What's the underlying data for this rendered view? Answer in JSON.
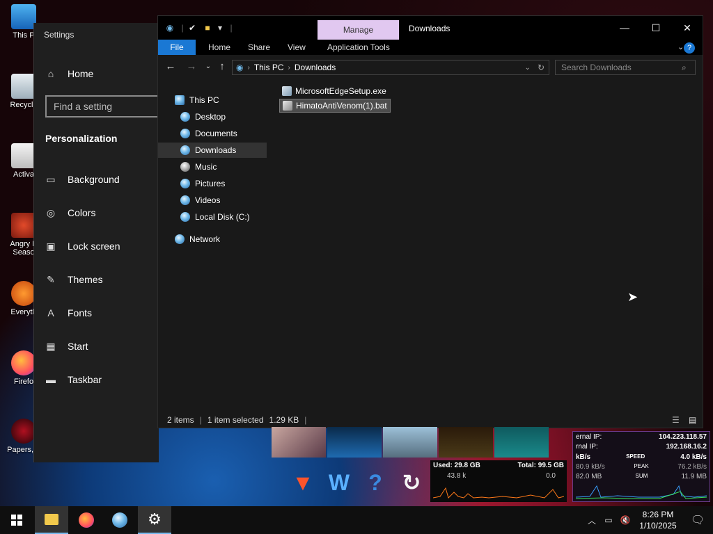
{
  "desktop": {
    "icons": [
      {
        "label": "This P"
      },
      {
        "label": "Recycle"
      },
      {
        "label": "Activa"
      },
      {
        "label": "Angry B Seaso"
      },
      {
        "label": "Everyth"
      },
      {
        "label": "Firefo"
      },
      {
        "label": "Papers, F"
      }
    ]
  },
  "settings": {
    "title": "Settings",
    "home_label": "Home",
    "search_placeholder": "Find a setting",
    "section_title": "Personalization",
    "items": [
      {
        "label": "Background",
        "icon": "image-icon"
      },
      {
        "label": "Colors",
        "icon": "palette-icon"
      },
      {
        "label": "Lock screen",
        "icon": "lock-screen-icon"
      },
      {
        "label": "Themes",
        "icon": "brush-icon"
      },
      {
        "label": "Fonts",
        "icon": "font-icon"
      },
      {
        "label": "Start",
        "icon": "start-icon"
      },
      {
        "label": "Taskbar",
        "icon": "taskbar-icon"
      }
    ]
  },
  "explorer": {
    "title": "Downloads",
    "manage_tab": "Manage",
    "ribbon_tabs": {
      "file": "File",
      "home": "Home",
      "share": "Share",
      "view": "View",
      "app_tools": "Application Tools"
    },
    "address": {
      "crumb1": "This PC",
      "crumb2": "Downloads"
    },
    "search_placeholder": "Search Downloads",
    "nav": [
      {
        "label": "This PC"
      },
      {
        "label": "Desktop"
      },
      {
        "label": "Documents"
      },
      {
        "label": "Downloads"
      },
      {
        "label": "Music"
      },
      {
        "label": "Pictures"
      },
      {
        "label": "Videos"
      },
      {
        "label": "Local Disk (C:)"
      },
      {
        "label": "Network"
      }
    ],
    "files": [
      {
        "name": "MicrosoftEdgeSetup.exe"
      },
      {
        "name": "HimatoAntiVenom(1).bat"
      }
    ],
    "status": {
      "count": "2 items",
      "selected": "1 item selected",
      "size": "1.29 KB"
    }
  },
  "widgets": {
    "mem": {
      "used": "Used: 29.8 GB",
      "total": "Total: 99.5 GB",
      "val1": "43.8 k",
      "val2": "0.0"
    },
    "net": {
      "ext_label": "ernal IP:",
      "ext_ip": "104.223.118.57",
      "int_label": "rnal IP:",
      "int_ip": "192.168.16.2",
      "row1_left": "kB/s",
      "row1_mid": "SPEED",
      "row1_right": "4.0 kB/s",
      "row2_left": "80.9 kB/s",
      "row2_mid": "PEAK",
      "row2_right": "76.2 kB/s",
      "row3_left": "82.0 MB",
      "row3_mid": "SUM",
      "row3_right": "11.9 MB"
    }
  },
  "taskbar": {
    "time": "8:26 PM",
    "date": "1/10/2025"
  },
  "colors": {
    "accent": "#1a78d4",
    "manage_tab": "#e1c8f0",
    "selection": "#4d4d4d"
  }
}
